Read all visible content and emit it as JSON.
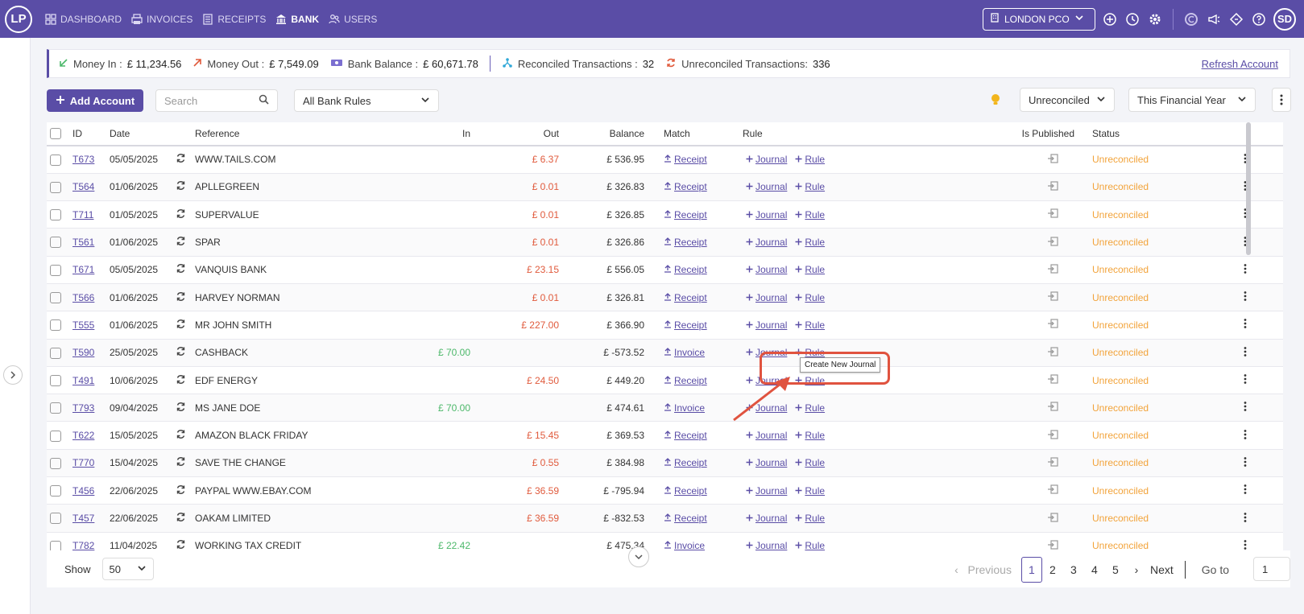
{
  "nav": {
    "logo": "LP",
    "items": [
      {
        "label": "DASHBOARD",
        "icon": "grid-icon"
      },
      {
        "label": "INVOICES",
        "icon": "printer-icon"
      },
      {
        "label": "RECEIPTS",
        "icon": "list-icon"
      },
      {
        "label": "BANK",
        "icon": "bank-icon"
      },
      {
        "label": "USERS",
        "icon": "users-icon"
      }
    ],
    "active": "BANK",
    "org": "LONDON PCO",
    "avatar": "SD"
  },
  "summary": {
    "money_in_label": "Money In :",
    "money_in": "£ 11,234.56",
    "money_out_label": "Money Out :",
    "money_out": "£ 7,549.09",
    "balance_label": "Bank Balance :",
    "balance": "£ 60,671.78",
    "reconciled_label": "Reconciled Transactions :",
    "reconciled": "32",
    "unreconciled_label": "Unreconciled Transactions:",
    "unreconciled": "336",
    "refresh": "Refresh Account"
  },
  "toolbar": {
    "add_account": "Add Account",
    "search_placeholder": "Search",
    "rules_filter": "All Bank Rules",
    "status_filter": "Unreconciled",
    "period_filter": "This Financial Year"
  },
  "table": {
    "headers": [
      "ID",
      "Date",
      "Reference",
      "In",
      "Out",
      "Balance",
      "Match",
      "Rule",
      "Is Published",
      "Status"
    ],
    "rows": [
      {
        "id": "T673",
        "date": "05/05/2025",
        "ref": "WWW.TAILS.COM",
        "in": "",
        "out": "£ 6.37",
        "balance": "£ 536.95",
        "match": "Receipt",
        "status": "Unreconciled"
      },
      {
        "id": "T564",
        "date": "01/06/2025",
        "ref": "APLLEGREEN",
        "in": "",
        "out": "£ 0.01",
        "balance": "£ 326.83",
        "match": "Receipt",
        "status": "Unreconciled"
      },
      {
        "id": "T711",
        "date": "01/05/2025",
        "ref": "SUPERVALUE",
        "in": "",
        "out": "£ 0.01",
        "balance": "£ 326.85",
        "match": "Receipt",
        "status": "Unreconciled"
      },
      {
        "id": "T561",
        "date": "01/06/2025",
        "ref": "SPAR",
        "in": "",
        "out": "£ 0.01",
        "balance": "£ 326.86",
        "match": "Receipt",
        "status": "Unreconciled"
      },
      {
        "id": "T671",
        "date": "05/05/2025",
        "ref": "VANQUIS BANK",
        "in": "",
        "out": "£ 23.15",
        "balance": "£ 556.05",
        "match": "Receipt",
        "status": "Unreconciled"
      },
      {
        "id": "T566",
        "date": "01/06/2025",
        "ref": "HARVEY NORMAN",
        "in": "",
        "out": "£ 0.01",
        "balance": "£ 326.81",
        "match": "Receipt",
        "status": "Unreconciled"
      },
      {
        "id": "T555",
        "date": "01/06/2025",
        "ref": "MR JOHN SMITH",
        "in": "",
        "out": "£ 227.00",
        "balance": "£ 366.90",
        "match": "Receipt",
        "status": "Unreconciled"
      },
      {
        "id": "T590",
        "date": "25/05/2025",
        "ref": "CASHBACK",
        "in": "£ 70.00",
        "out": "",
        "balance": "£ -573.52",
        "match": "Invoice",
        "status": "Unreconciled"
      },
      {
        "id": "T491",
        "date": "10/06/2025",
        "ref": "EDF ENERGY",
        "in": "",
        "out": "£ 24.50",
        "balance": "£ 449.20",
        "match": "Receipt",
        "status": "Unreconciled"
      },
      {
        "id": "T793",
        "date": "09/04/2025",
        "ref": "MS JANE DOE",
        "in": "£ 70.00",
        "out": "",
        "balance": "£ 474.61",
        "match": "Invoice",
        "status": "Unreconciled"
      },
      {
        "id": "T622",
        "date": "15/05/2025",
        "ref": "AMAZON BLACK FRIDAY",
        "in": "",
        "out": "£ 15.45",
        "balance": "£ 369.53",
        "match": "Receipt",
        "status": "Unreconciled"
      },
      {
        "id": "T770",
        "date": "15/04/2025",
        "ref": "SAVE THE CHANGE",
        "in": "",
        "out": "£ 0.55",
        "balance": "£ 384.98",
        "match": "Receipt",
        "status": "Unreconciled"
      },
      {
        "id": "T456",
        "date": "22/06/2025",
        "ref": "PAYPAL WWW.EBAY.COM",
        "in": "",
        "out": "£ 36.59",
        "balance": "£ -795.94",
        "match": "Receipt",
        "status": "Unreconciled"
      },
      {
        "id": "T457",
        "date": "22/06/2025",
        "ref": "OAKAM LIMITED",
        "in": "",
        "out": "£ 36.59",
        "balance": "£ -832.53",
        "match": "Receipt",
        "status": "Unreconciled"
      },
      {
        "id": "T782",
        "date": "11/04/2025",
        "ref": "WORKING TAX CREDIT",
        "in": "£ 22.42",
        "out": "",
        "balance": "£ 475.34",
        "match": "Invoice",
        "status": "Unreconciled"
      }
    ],
    "journal_label": "Journal",
    "rule_label": "Rule"
  },
  "tooltip": "Create New Journal",
  "footer": {
    "show_label": "Show",
    "page_size": "50",
    "previous": "Previous",
    "pages": [
      "1",
      "2",
      "3",
      "4",
      "5"
    ],
    "current_page": "1",
    "next": "Next",
    "goto_label": "Go to",
    "goto_value": "1"
  },
  "colors": {
    "brand": "#5a4da6",
    "negative": "#e05a3c",
    "positive": "#4cb86a",
    "status": "#f2a33a",
    "annotation": "#e0533f"
  }
}
